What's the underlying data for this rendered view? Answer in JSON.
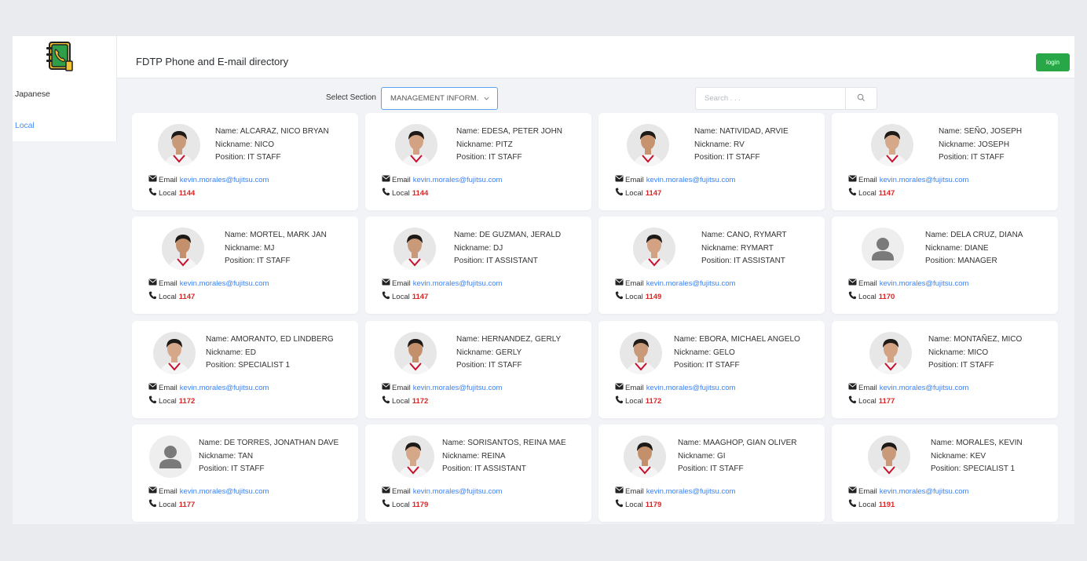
{
  "sidebar": {
    "items": [
      {
        "label": "Japanese"
      },
      {
        "label": "Local"
      }
    ]
  },
  "header": {
    "title": "FDTP Phone and E-mail directory",
    "login_label": "login"
  },
  "filter": {
    "section_label": "Select Section",
    "section_value": "MANAGEMENT INFORM.",
    "search_placeholder": "Search . . ."
  },
  "labels": {
    "name": "Name:",
    "nickname": "Nickname:",
    "position": "Position:",
    "email": "Email",
    "local": "Local"
  },
  "colors": {
    "accent": "#4a8ff7",
    "login": "#27a745",
    "local_number": "#dc2626"
  },
  "employees": [
    {
      "name": "ALCARAZ, NICO BRYAN",
      "nickname": "NICO",
      "position": "IT STAFF",
      "email": "kevin.morales@fujitsu.com",
      "local": "1144",
      "photo": "photo"
    },
    {
      "name": "EDESA, PETER JOHN",
      "nickname": "PITZ",
      "position": "IT STAFF",
      "email": "kevin.morales@fujitsu.com",
      "local": "1144",
      "photo": "photo"
    },
    {
      "name": "NATIVIDAD, ARVIE",
      "nickname": "RV",
      "position": "IT STAFF",
      "email": "kevin.morales@fujitsu.com",
      "local": "1147",
      "photo": "photo"
    },
    {
      "name": "SEÑO, JOSEPH",
      "nickname": "JOSEPH",
      "position": "IT STAFF",
      "email": "kevin.morales@fujitsu.com",
      "local": "1147",
      "photo": "photo"
    },
    {
      "name": "MORTEL, MARK JAN",
      "nickname": "MJ",
      "position": "IT STAFF",
      "email": "kevin.morales@fujitsu.com",
      "local": "1147",
      "photo": "photo"
    },
    {
      "name": "DE GUZMAN, JERALD",
      "nickname": "DJ",
      "position": "IT ASSISTANT",
      "email": "kevin.morales@fujitsu.com",
      "local": "1147",
      "photo": "photo"
    },
    {
      "name": "CANO, RYMART",
      "nickname": "RYMART",
      "position": "IT ASSISTANT",
      "email": "kevin.morales@fujitsu.com",
      "local": "1149",
      "photo": "photo"
    },
    {
      "name": "DELA CRUZ, DIANA",
      "nickname": "DIANE",
      "position": "MANAGER",
      "email": "kevin.morales@fujitsu.com",
      "local": "1170",
      "photo": "placeholder"
    },
    {
      "name": "AMORANTO, ED LINDBERG",
      "nickname": "ED",
      "position": "SPECIALIST 1",
      "email": "kevin.morales@fujitsu.com",
      "local": "1172",
      "photo": "photo"
    },
    {
      "name": "HERNANDEZ, GERLY",
      "nickname": "GERLY",
      "position": "IT STAFF",
      "email": "kevin.morales@fujitsu.com",
      "local": "1172",
      "photo": "photo"
    },
    {
      "name": "EBORA, MICHAEL ANGELO",
      "nickname": "GELO",
      "position": "IT STAFF",
      "email": "kevin.morales@fujitsu.com",
      "local": "1172",
      "photo": "photo"
    },
    {
      "name": "MONTAÑEZ, MICO",
      "nickname": "MICO",
      "position": "IT STAFF",
      "email": "kevin.morales@fujitsu.com",
      "local": "1177",
      "photo": "photo"
    },
    {
      "name": "DE TORRES, JONATHAN DAVE",
      "nickname": "TAN",
      "position": "IT STAFF",
      "email": "kevin.morales@fujitsu.com",
      "local": "1177",
      "photo": "placeholder"
    },
    {
      "name": "SORISANTOS, REINA MAE",
      "nickname": "REINA",
      "position": "IT ASSISTANT",
      "email": "kevin.morales@fujitsu.com",
      "local": "1179",
      "photo": "photo"
    },
    {
      "name": "MAAGHOP, GIAN OLIVER",
      "nickname": "GI",
      "position": "IT STAFF",
      "email": "kevin.morales@fujitsu.com",
      "local": "1179",
      "photo": "photo"
    },
    {
      "name": "MORALES, KEVIN",
      "nickname": "KEV",
      "position": "SPECIALIST 1",
      "email": "kevin.morales@fujitsu.com",
      "local": "1191",
      "photo": "photo"
    }
  ]
}
